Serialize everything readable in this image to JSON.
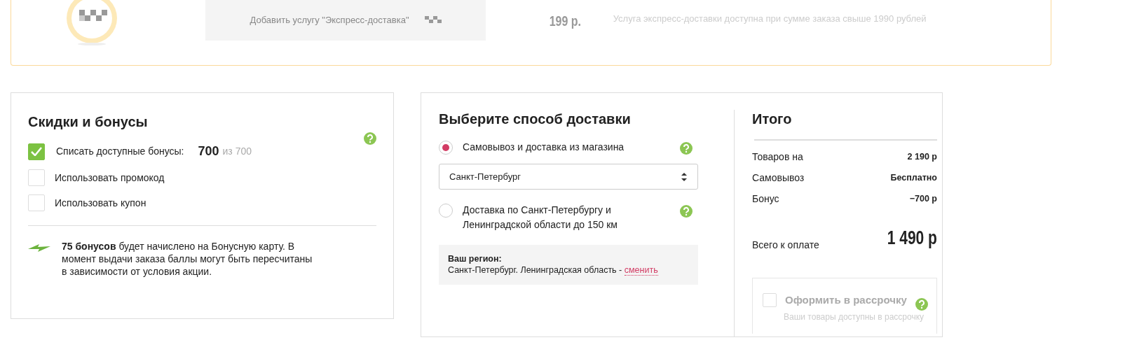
{
  "express": {
    "button_label": "Добавить услугу \"Экспресс-доставка\"",
    "price": "199 р.",
    "note": "Услуга экспресс-доставки доступна при сумме заказа свыше 1990 рублей"
  },
  "discounts": {
    "title": "Скидки и бонусы",
    "options": [
      {
        "label": "Списать доступные бонусы:",
        "checked": true,
        "amount": "700",
        "of": "из 700"
      },
      {
        "label": "Использовать промокод",
        "checked": false
      },
      {
        "label": "Использовать купон",
        "checked": false
      }
    ],
    "bonus_note": "**75 бонусов** будет начислено на Бонусную карту. В момент выдачи заказа баллы могут быть пересчитаны в зависимости от условия акции."
  },
  "delivery": {
    "title": "Выберите способ доставки",
    "options": [
      {
        "label": "Самовывоз и доставка из магазина",
        "selected": true,
        "select_value": "Санкт-Петербург"
      },
      {
        "label": "Доставка по Санкт-Петербургу и Ленинградской области до 150 км",
        "selected": false
      }
    ],
    "region": {
      "label": "Ваш регион:",
      "text": "Санкт-Петербург. Ленинградская область -",
      "link": "сменить"
    }
  },
  "summary": {
    "title": "Итого",
    "rows": [
      {
        "label": "Товаров на",
        "value": "2 190 р"
      },
      {
        "label": "Самовывоз",
        "value": "Бесплатно"
      },
      {
        "label": "Бонус",
        "value": "−700 р"
      }
    ],
    "total": {
      "label": "Всего к оплате",
      "value": "1 490 р"
    },
    "installment": {
      "label": "Оформить в рассрочку",
      "checked": false,
      "disabled": true,
      "note": "Ваши товары доступны в рассрочку"
    }
  }
}
